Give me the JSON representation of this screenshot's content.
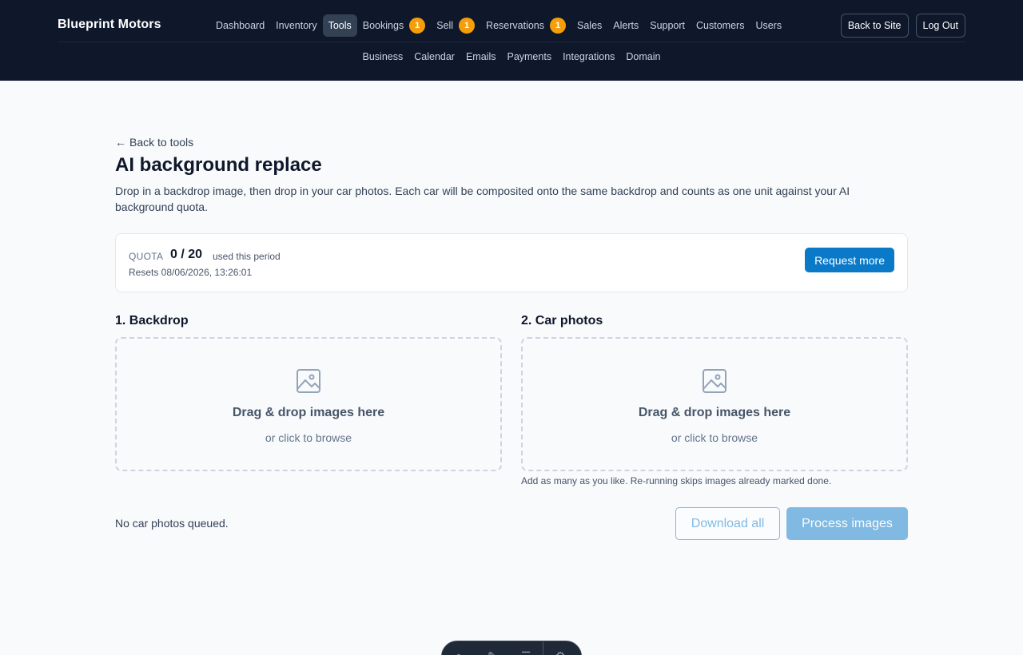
{
  "brand": "Blueprint Motors",
  "nav": {
    "primary": [
      {
        "label": "Dashboard",
        "badge": null,
        "active": false
      },
      {
        "label": "Inventory",
        "badge": null,
        "active": false
      },
      {
        "label": "Tools",
        "badge": null,
        "active": true
      },
      {
        "label": "Bookings",
        "badge": "1",
        "active": false
      },
      {
        "label": "Sell",
        "badge": "1",
        "active": false
      },
      {
        "label": "Reservations",
        "badge": "1",
        "active": false
      },
      {
        "label": "Sales",
        "badge": null,
        "active": false
      },
      {
        "label": "Alerts",
        "badge": null,
        "active": false
      },
      {
        "label": "Support",
        "badge": null,
        "active": false
      },
      {
        "label": "Customers",
        "badge": null,
        "active": false
      },
      {
        "label": "Users",
        "badge": null,
        "active": false
      }
    ],
    "secondary": [
      {
        "label": "Business"
      },
      {
        "label": "Calendar"
      },
      {
        "label": "Emails"
      },
      {
        "label": "Payments"
      },
      {
        "label": "Integrations"
      },
      {
        "label": "Domain"
      }
    ],
    "actions": {
      "back_to_site": "Back to Site",
      "log_out": "Log Out"
    }
  },
  "page": {
    "back_link": "Back to tools",
    "title": "AI background replace",
    "description": "Drop in a backdrop image, then drop in your car photos. Each car will be composited onto the same backdrop and counts as one unit against your AI background quota."
  },
  "quota": {
    "label": "QUOTA",
    "value": "0 / 20",
    "suffix": "used this period",
    "reset": "Resets 08/06/2026, 13:26:01",
    "request_button": "Request more"
  },
  "backdrop": {
    "title": "1. Backdrop",
    "drop_title": "Drag & drop images here",
    "drop_sub": "or click to browse"
  },
  "car_photos": {
    "title": "2. Car photos",
    "drop_title": "Drag & drop images here",
    "drop_sub": "or click to browse",
    "hint": "Add as many as you like. Re-running skips images already marked done."
  },
  "queue": {
    "empty_text": "No car photos queued.",
    "download_button": "Download all",
    "process_button": "Process images"
  },
  "colors": {
    "topbar": "#0f172a",
    "primary": "#0a7ac8",
    "badge": "#f59e0b"
  }
}
